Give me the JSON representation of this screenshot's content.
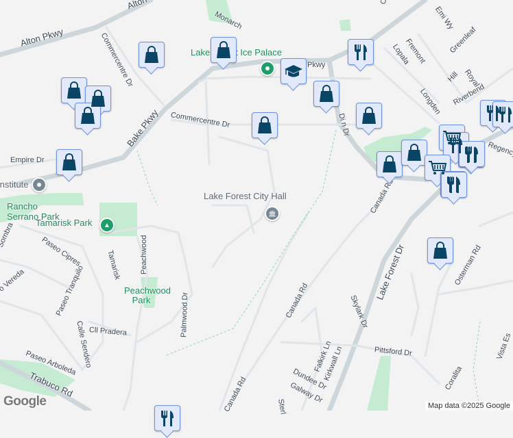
{
  "map": {
    "roads": {
      "alton": "Alton Pkwy",
      "alton_top": "Alton",
      "bake": "Bake Pkwy",
      "commercentre_1": "Commercentre Dr",
      "commercentre_2": "Commercentre Dr",
      "monarch": "Monarch",
      "empire": "Empire Dr",
      "pkwy_partial": "Pkwy",
      "dimension_partial": "Di    n Dr",
      "orchard_partial": "Or",
      "emi": "Emi Wy",
      "fremont": "Fremont",
      "lopala": "Lopala",
      "greenleaf": "Greenleaf",
      "hill": "Hill",
      "royal": "Royal",
      "longden": "Longden",
      "riverbend": "Riverbend",
      "regency": "Regency",
      "canada_1": "Canada Rd",
      "canada_2": "Canada Rd",
      "canada_3": "Canada Rd",
      "lake_forest_dr": "Lake Forest Dr",
      "skylark": "Skylark Dr",
      "osterman": "Osterman Rd",
      "pittsford": "Pittsford Dr",
      "falkirk": "Falkirk Ln",
      "kirkwall": "Kirkwall Ln",
      "dundee": "Dundee Dr",
      "galway": "Galway Dr",
      "sterling_partial": "Sterl",
      "coralita": "Coralita",
      "vista_partial": "Vista Es",
      "sombra_partial": "Sombra",
      "paseo_cipres": "Paseo Cipres",
      "vereda_partial": "o Vereda",
      "paseo_tranquilo": "Paseo Tranquilo",
      "tamarisk": "Tamarisk",
      "peachwood": "Peachwood",
      "palmwood": "Palmwood Dr",
      "calle_sendero": "Calle Sendero",
      "cll_pradera": "Cll Pradera",
      "paseo_arboleda": "Paseo Arboleda",
      "trabuco": "Trabuco Rd"
    },
    "places": {
      "ice_palace": "Lake Forest Ice Palace",
      "city_hall": "Lake Forest City Hall",
      "institute_partial": "Institute",
      "rancho_serrano": "Rancho Serrano Park",
      "tamarisk_park": "Tamarisk Park",
      "peachwood_park": "Peachwood Park"
    },
    "attribution": "Map data ©2025 Google",
    "logo": "Google",
    "colors": {
      "marker_fill": "#e1e9fb",
      "marker_border": "#6e92db",
      "icon": "#0b4566",
      "park": "#c2ecd2",
      "road": "#d4dce1"
    }
  }
}
